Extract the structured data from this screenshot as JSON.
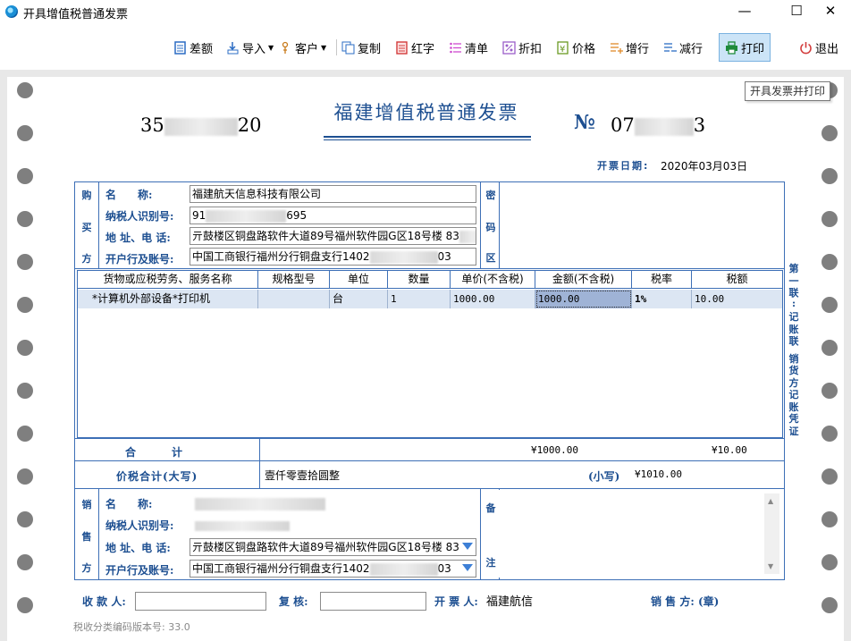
{
  "window": {
    "title": "开具增值税普通发票",
    "minimize": "—",
    "maximize": "☐",
    "close": "✕"
  },
  "toolbar": {
    "items": [
      {
        "label": "差额",
        "icon": "list-doc-icon"
      },
      {
        "label": "导入",
        "icon": "import-icon"
      },
      {
        "label": "客户",
        "icon": "customer-icon"
      },
      {
        "label": "复制",
        "icon": "copy-icon"
      },
      {
        "label": "红字",
        "icon": "red-invoice-icon"
      },
      {
        "label": "清单",
        "icon": "checklist-icon"
      },
      {
        "label": "折扣",
        "icon": "discount-icon"
      },
      {
        "label": "价格",
        "icon": "price-icon"
      },
      {
        "label": "增行",
        "icon": "add-row-icon"
      },
      {
        "label": "减行",
        "icon": "remove-row-icon"
      },
      {
        "label": "打印",
        "icon": "printer-icon"
      },
      {
        "label": "退出",
        "icon": "power-icon"
      }
    ],
    "tooltip": "开具发票并打印"
  },
  "invoice": {
    "title": "福建增值税普通发票",
    "code_prefix": "35",
    "code_suffix": "20",
    "no_symbol": "№",
    "no_prefix": "07",
    "no_suffix": "3",
    "issue_date_label": "开票日期:",
    "issue_date": "2020年03月03日",
    "buyer": {
      "side_label": [
        "购",
        "买",
        "方"
      ],
      "name_label": "名　　称:",
      "name": "福建航天信息科技有限公司",
      "tax_id_label": "纳税人识别号:",
      "tax_id_prefix": "91",
      "tax_id_suffix": "695",
      "address_label": "地 址、电 话:",
      "address": "亓鼓楼区铜盘路软件大道89号福州软件园G区18号楼  83",
      "address_suffix": "8",
      "bank_label": "开户行及账号:",
      "bank": "中国工商银行福州分行铜盘支行1402",
      "bank_suffix": "03"
    },
    "cipher_label": [
      "密",
      "码",
      "区"
    ],
    "copy_label": [
      "第",
      "一",
      "联",
      ":",
      "记",
      "账",
      "联",
      "",
      "销",
      "货",
      "方",
      "记",
      "账",
      "凭",
      "证"
    ],
    "columns": [
      "货物或应税劳务、服务名称",
      "规格型号",
      "单位",
      "数量",
      "单价(不含税)",
      "金额(不含税)",
      "税率",
      "税额"
    ],
    "rows": [
      {
        "name": "*计算机外部设备*打印机",
        "spec": "",
        "unit": "台",
        "qty": "1",
        "price": "1000.00",
        "amount": "1000.00",
        "rate": "1%",
        "tax": "10.00"
      }
    ],
    "total_label": "合　　　计",
    "total_amount": "¥1000.00",
    "total_tax": "¥10.00",
    "grand_label": "价税合计(大写)",
    "grand_words": "壹仟零壹拾圆整",
    "grand_small_label": "(小写)",
    "grand_small": "¥1010.00",
    "seller": {
      "side_label": [
        "销",
        "售",
        "方"
      ],
      "name_label": "名　　称:",
      "tax_id_label": "纳税人识别号:",
      "address_label": "地 址、电 话:",
      "address": "亓鼓楼区铜盘路软件大道89号福州软件园G区18号楼  83",
      "bank_label": "开户行及账号:",
      "bank": "中国工商银行福州分行铜盘支行1402",
      "bank_suffix": "03"
    },
    "remarks_label": [
      "备",
      "注"
    ],
    "payee_label": "收 款 人:",
    "reviewer_label": "复 核:",
    "drawer_label": "开 票 人:",
    "drawer": "福建航信",
    "seller_seal_label": "销 售 方: (章)",
    "version_text": "税收分类编码版本号: 33.0"
  },
  "colors": {
    "accent": "#1d4f91",
    "line": "#3d6fb6",
    "selected_row": "#dce6f3"
  }
}
